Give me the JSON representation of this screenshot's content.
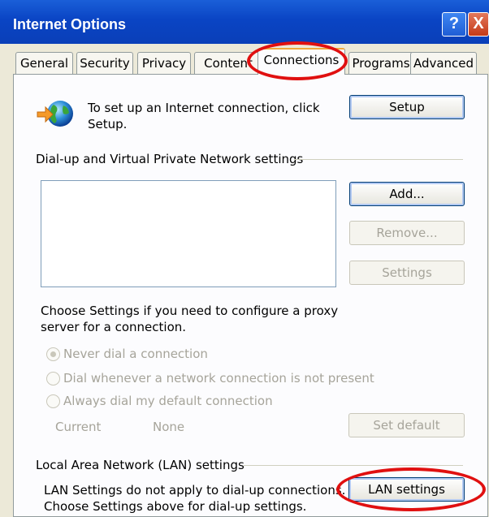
{
  "window": {
    "title": "Internet Options",
    "help_label": "?",
    "close_label": "X"
  },
  "tabs": [
    {
      "label": "General"
    },
    {
      "label": "Security"
    },
    {
      "label": "Privacy"
    },
    {
      "label": "Content"
    },
    {
      "label": "Connections"
    },
    {
      "label": "Programs"
    },
    {
      "label": "Advanced"
    }
  ],
  "setup_section": {
    "text_line1": "To set up an Internet connection, click",
    "text_line2": "Setup.",
    "setup_button": "Setup",
    "icon": "internet-globe-icon"
  },
  "dialup": {
    "heading": "Dial-up and Virtual Private Network settings",
    "add_button": "Add...",
    "remove_button": "Remove...",
    "settings_button": "Settings",
    "proxy_note_line1": "Choose Settings if you need to configure a proxy",
    "proxy_note_line2": "server for a connection.",
    "options": [
      {
        "label": "Never dial a connection",
        "checked": true
      },
      {
        "label": "Dial whenever a network connection is not present",
        "checked": false
      },
      {
        "label": "Always dial my default connection",
        "checked": false
      }
    ],
    "current_label": "Current",
    "current_value": "None",
    "set_default_button": "Set default"
  },
  "lan": {
    "heading": "Local Area Network (LAN) settings",
    "note_line1": "LAN Settings do not apply to dial-up connections.",
    "note_line2": "Choose Settings above for dial-up settings.",
    "lan_settings_button": "LAN settings"
  },
  "colors": {
    "title_bar": "#0a44c4",
    "annotation": "#e01010",
    "dialog": "#ece9d8"
  }
}
